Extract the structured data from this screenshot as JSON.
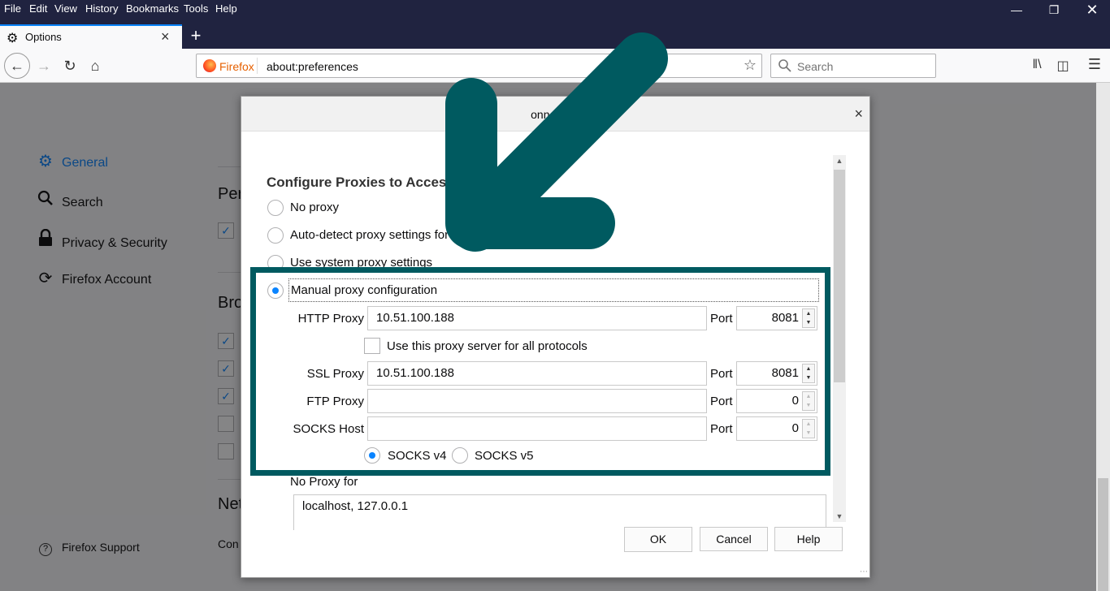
{
  "menubar": {
    "items": [
      "File",
      "Edit",
      "View",
      "History",
      "Bookmarks",
      "Tools",
      "Help"
    ]
  },
  "tab": {
    "title": "Options",
    "close": "×",
    "new_tab": "+"
  },
  "navbar": {
    "identity_label": "Firefox",
    "url": "about:preferences",
    "search_placeholder": "Search"
  },
  "sidebar": {
    "items": [
      {
        "label": "General",
        "icon": "gear-icon",
        "selected": true
      },
      {
        "label": "Search",
        "icon": "search-icon",
        "selected": false
      },
      {
        "label": "Privacy & Security",
        "icon": "lock-icon",
        "selected": false
      },
      {
        "label": "Firefox Account",
        "icon": "sync-icon",
        "selected": false
      }
    ],
    "support": "Firefox Support"
  },
  "background": {
    "headings": [
      "Per",
      "Bro",
      "Net"
    ],
    "text": "Con"
  },
  "dialog": {
    "title": "onnection",
    "close": "×",
    "section_title": "Configure Proxies to Access t",
    "options": {
      "no_proxy": "No proxy",
      "auto_detect": "Auto-detect proxy settings for",
      "system": "Use system proxy settings",
      "manual": "Manual proxy configuration"
    },
    "http_proxy": {
      "label": "HTTP Proxy",
      "value": "10.51.100.188",
      "port_label": "Port",
      "port": "8081"
    },
    "use_for_all": "Use this proxy server for all protocols",
    "ssl_proxy": {
      "label": "SSL Proxy",
      "value": "10.51.100.188",
      "port_label": "Port",
      "port": "8081"
    },
    "ftp_proxy": {
      "label": "FTP Proxy",
      "value": "",
      "port_label": "Port",
      "port": "0"
    },
    "socks_host": {
      "label": "SOCKS Host",
      "value": "",
      "port_label": "Port",
      "port": "0"
    },
    "socks_v4": "SOCKS v4",
    "socks_v5": "SOCKS v5",
    "no_proxy_for_label": "No Proxy for",
    "no_proxy_for_value": "localhost, 127.0.0.1",
    "buttons": {
      "ok": "OK",
      "cancel": "Cancel",
      "help": "Help"
    }
  },
  "colors": {
    "accent": "#0a84ff",
    "highlight_border": "#005a60",
    "titlebar": "#202340"
  }
}
